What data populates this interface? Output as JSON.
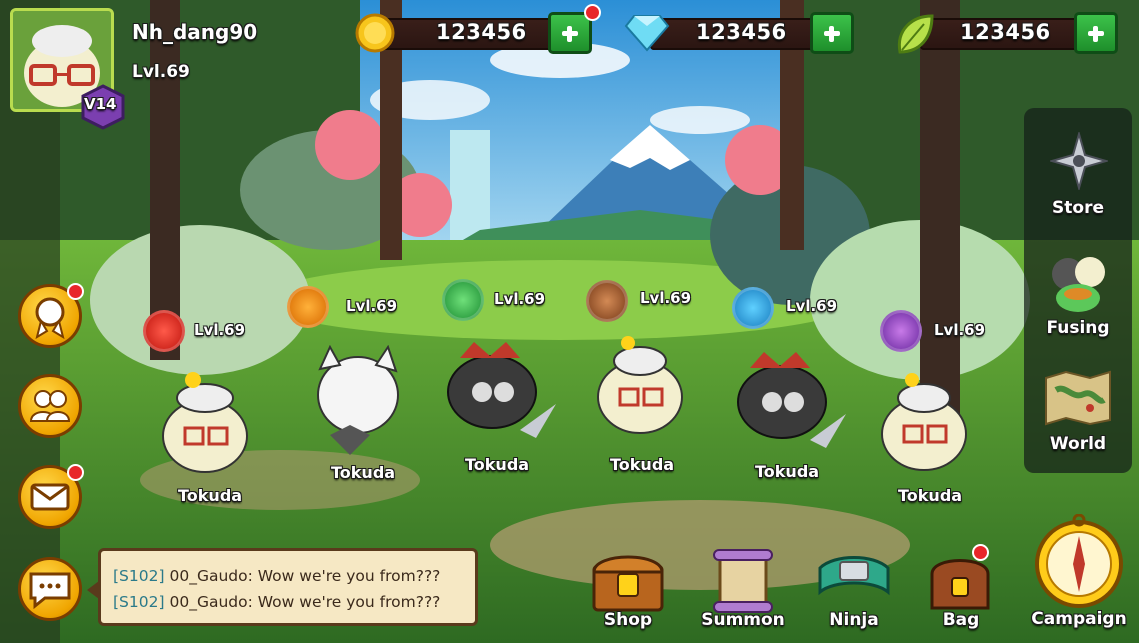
{
  "player": {
    "name": "Nh_dang90",
    "level": "Lvl.69",
    "vip": "V14"
  },
  "currencies": [
    {
      "icon": "gold-coin-icon",
      "value": "123456"
    },
    {
      "icon": "diamond-icon",
      "value": "123456"
    },
    {
      "icon": "leaf-icon",
      "value": "123456"
    }
  ],
  "right_menu": {
    "store": "Store",
    "fusing": "Fusing",
    "world": "World"
  },
  "bottom_menu": {
    "shop": "Shop",
    "summon": "Summon",
    "ninja": "Ninja",
    "bag": "Bag",
    "campaign": "Campaign"
  },
  "team": [
    {
      "element": "fire",
      "level": "Lvl.69",
      "name": "Tokuda"
    },
    {
      "element": "lightning",
      "level": "Lvl.69",
      "name": "Tokuda"
    },
    {
      "element": "wind",
      "level": "Lvl.69",
      "name": "Tokuda"
    },
    {
      "element": "earth",
      "level": "Lvl.69",
      "name": "Tokuda"
    },
    {
      "element": "water",
      "level": "Lvl.69",
      "name": "Tokuda"
    },
    {
      "element": "yin-yang",
      "level": "Lvl.69",
      "name": "Tokuda"
    }
  ],
  "chat": [
    {
      "channel": "[S102]",
      "user": "00_Gaudo:",
      "message": "Wow we're you from???"
    },
    {
      "channel": "[S102]",
      "user": "00_Gaudo:",
      "message": "Wow we're you from???"
    }
  ],
  "colors": {
    "accent_gold": "#f0a500",
    "plus_green": "#2aa83a",
    "notification_red": "#e8262a",
    "vip_purple": "#7b3fb0"
  }
}
